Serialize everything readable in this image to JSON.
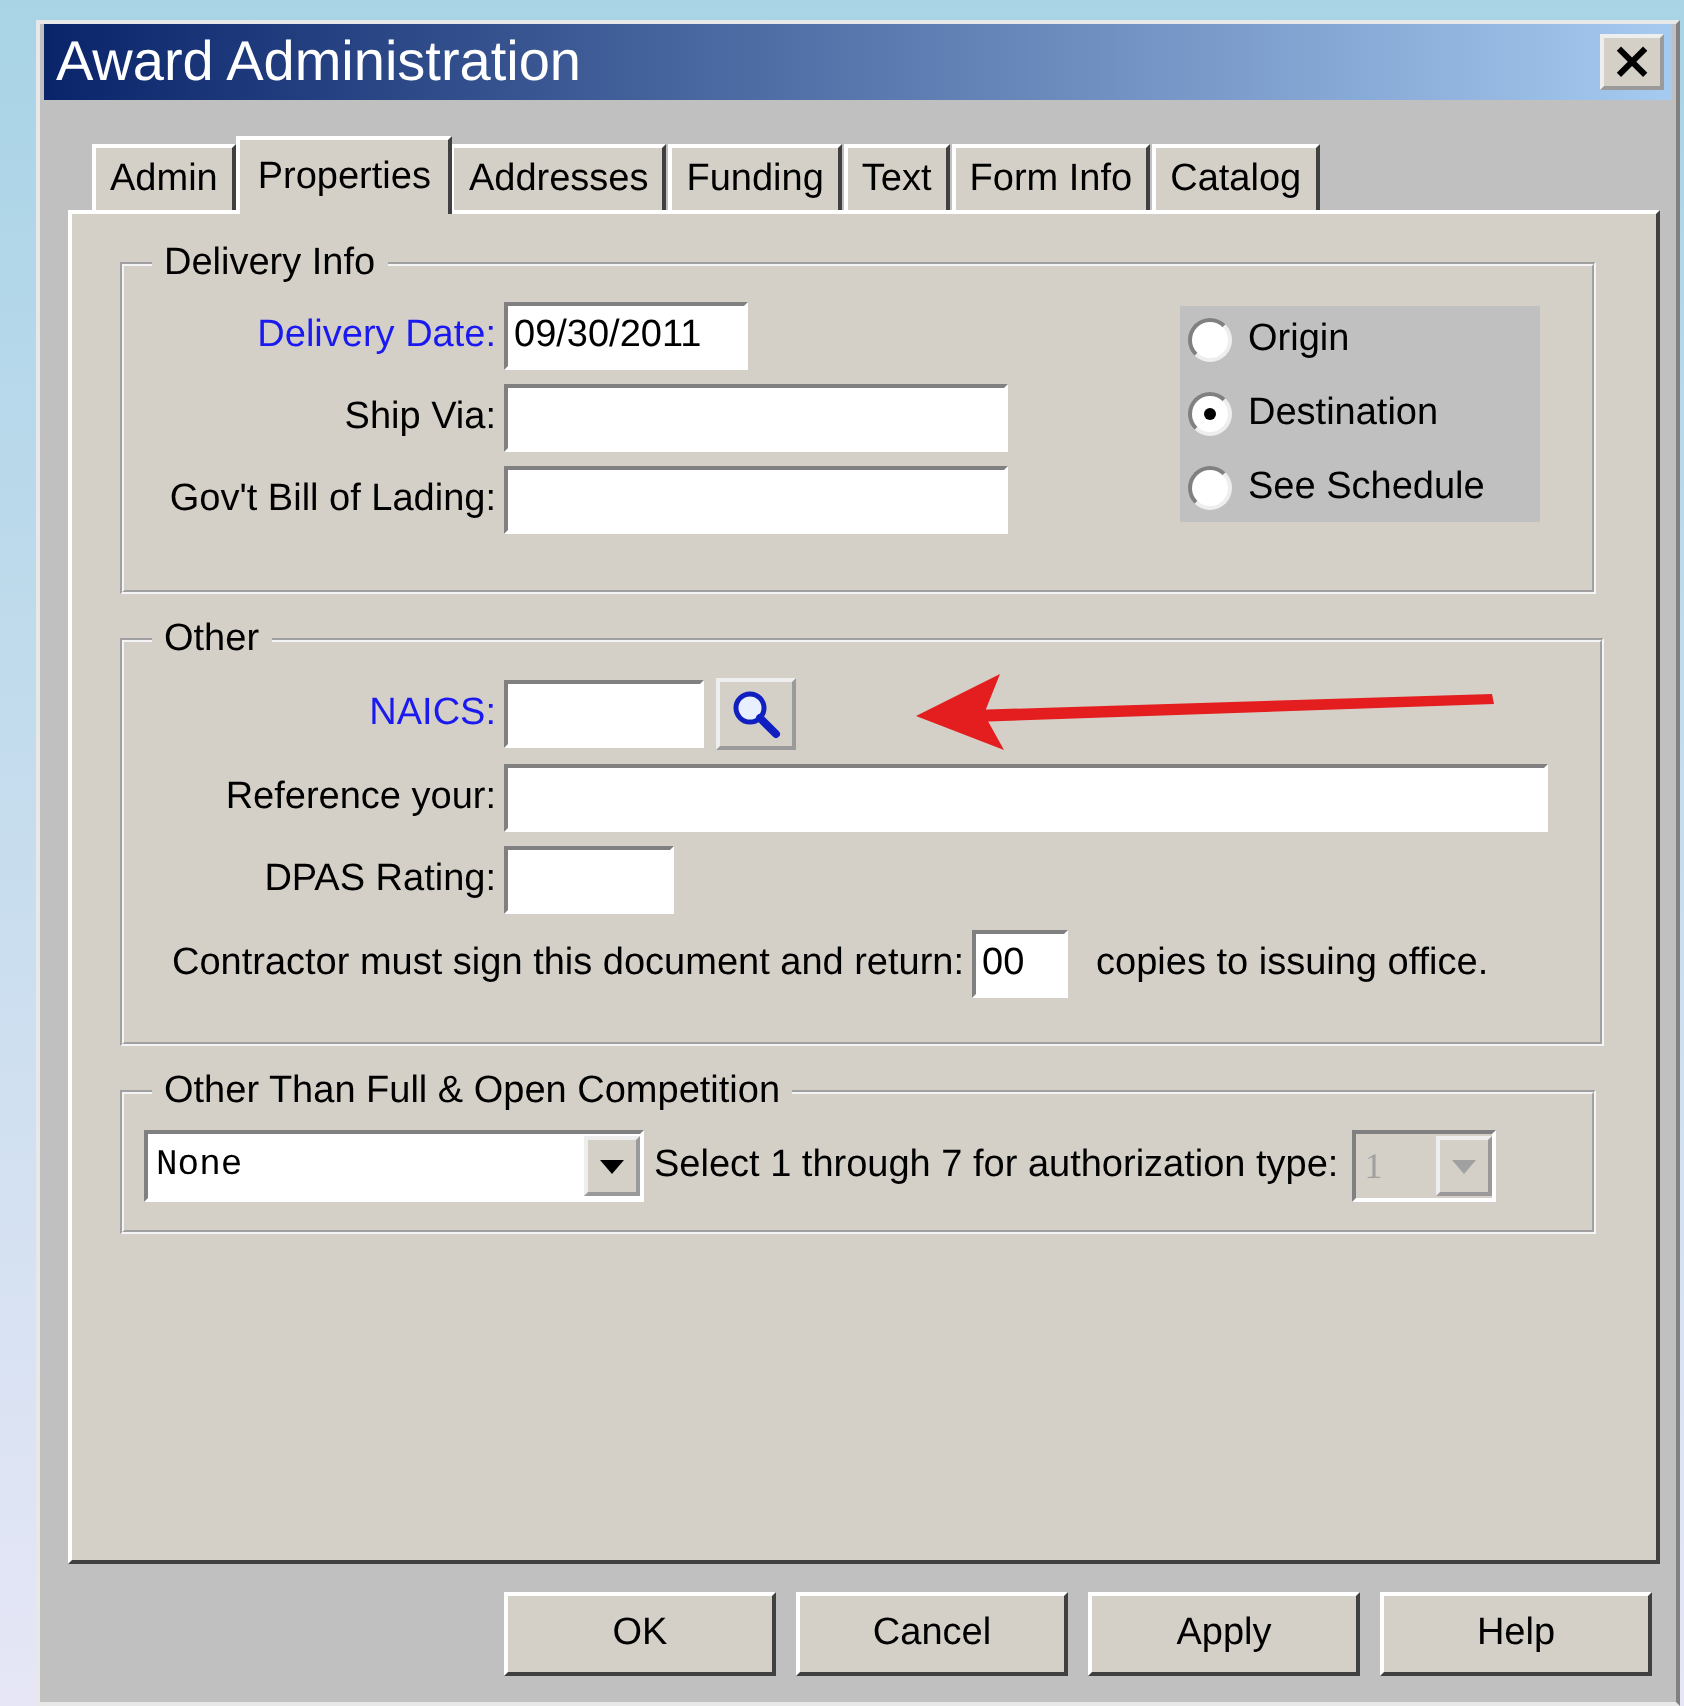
{
  "window": {
    "title": "Award Administration",
    "close": "×"
  },
  "tabs": [
    {
      "label": "Admin",
      "selected": false
    },
    {
      "label": "Properties",
      "selected": true
    },
    {
      "label": "Addresses",
      "selected": false
    },
    {
      "label": "Funding",
      "selected": false
    },
    {
      "label": "Text",
      "selected": false
    },
    {
      "label": "Form Info",
      "selected": false
    },
    {
      "label": "Catalog",
      "selected": false
    }
  ],
  "delivery_info": {
    "title": "Delivery Info",
    "fields": [
      {
        "label": "Delivery Date:",
        "value": "09/30/2011",
        "required": true,
        "kind": "date"
      },
      {
        "label": "Ship Via:",
        "required": false,
        "kind": "medium"
      },
      {
        "label": "Gov't Bill of Lading:",
        "required": false,
        "kind": "medium"
      }
    ],
    "options": [
      {
        "label": "Origin",
        "selected": false
      },
      {
        "label": "Destination",
        "selected": true
      },
      {
        "label": "See Schedule",
        "selected": false
      }
    ]
  },
  "other": {
    "title": "Other",
    "fields": [
      {
        "label": "NAICS:",
        "required": true,
        "kind": "lookup"
      },
      {
        "label": "Reference your:",
        "required": false,
        "kind": "wide"
      },
      {
        "label": "DPAS Rating:",
        "required": false,
        "kind": "short"
      }
    ],
    "copies": {
      "prefix": "Contractor must sign this document and return:",
      "value": "00",
      "suffix": "copies to issuing office."
    }
  },
  "competition": {
    "title": "Other Than Full & Open Competition",
    "selection": "None",
    "auth_label": "Select 1 through 7 for authorization type:",
    "auth_value": "1",
    "auth_disabled": true
  },
  "buttons": [
    {
      "label": "OK"
    },
    {
      "label": "Cancel"
    },
    {
      "label": "Apply"
    },
    {
      "label": "Help"
    }
  ]
}
